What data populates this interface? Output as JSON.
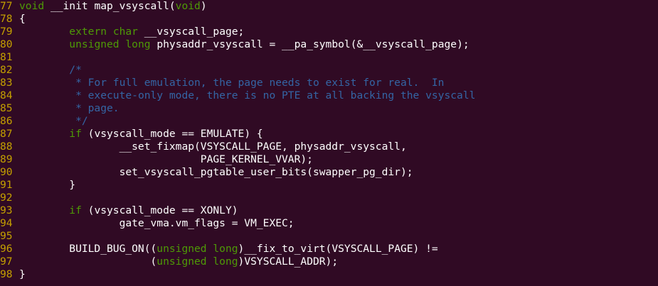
{
  "editor": {
    "colors": {
      "background": "#300a24",
      "line_number": "#c4a000",
      "keyword": "#4e9a06",
      "comment": "#3465a4",
      "text": "#ffffff"
    },
    "lines": [
      {
        "num": "77",
        "segments": [
          [
            "kw",
            "void"
          ],
          [
            "tx",
            " __init map_vsyscall("
          ],
          [
            "kw",
            "void"
          ],
          [
            "tx",
            ")"
          ]
        ]
      },
      {
        "num": "78",
        "segments": [
          [
            "tx",
            "{"
          ]
        ]
      },
      {
        "num": "79",
        "segments": [
          [
            "tx",
            "        "
          ],
          [
            "kw",
            "extern"
          ],
          [
            "tx",
            " "
          ],
          [
            "kw",
            "char"
          ],
          [
            "tx",
            " __vsyscall_page;"
          ]
        ]
      },
      {
        "num": "80",
        "segments": [
          [
            "tx",
            "        "
          ],
          [
            "kw",
            "unsigned"
          ],
          [
            "tx",
            " "
          ],
          [
            "kw",
            "long"
          ],
          [
            "tx",
            " physaddr_vsyscall = __pa_symbol(&__vsyscall_page);"
          ]
        ]
      },
      {
        "num": "81",
        "segments": []
      },
      {
        "num": "82",
        "segments": [
          [
            "tx",
            "        "
          ],
          [
            "cm",
            "/*"
          ]
        ]
      },
      {
        "num": "83",
        "segments": [
          [
            "tx",
            "         "
          ],
          [
            "cm",
            "* For full emulation, the page needs to exist for real.  In"
          ]
        ]
      },
      {
        "num": "84",
        "segments": [
          [
            "tx",
            "         "
          ],
          [
            "cm",
            "* execute-only mode, there is no PTE at all backing the vsyscall"
          ]
        ]
      },
      {
        "num": "85",
        "segments": [
          [
            "tx",
            "         "
          ],
          [
            "cm",
            "* page."
          ]
        ]
      },
      {
        "num": "86",
        "segments": [
          [
            "tx",
            "         "
          ],
          [
            "cm",
            "*/"
          ]
        ]
      },
      {
        "num": "87",
        "segments": [
          [
            "tx",
            "        "
          ],
          [
            "kw",
            "if"
          ],
          [
            "tx",
            " (vsyscall_mode == EMULATE) {"
          ]
        ]
      },
      {
        "num": "88",
        "segments": [
          [
            "tx",
            "                __set_fixmap(VSYSCALL_PAGE, physaddr_vsyscall,"
          ]
        ]
      },
      {
        "num": "89",
        "segments": [
          [
            "tx",
            "                             PAGE_KERNEL_VVAR);"
          ]
        ]
      },
      {
        "num": "90",
        "segments": [
          [
            "tx",
            "                set_vsyscall_pgtable_user_bits(swapper_pg_dir);"
          ]
        ]
      },
      {
        "num": "91",
        "segments": [
          [
            "tx",
            "        }"
          ]
        ]
      },
      {
        "num": "92",
        "segments": []
      },
      {
        "num": "93",
        "segments": [
          [
            "tx",
            "        "
          ],
          [
            "kw",
            "if"
          ],
          [
            "tx",
            " (vsyscall_mode == XONLY)"
          ]
        ]
      },
      {
        "num": "94",
        "segments": [
          [
            "tx",
            "                gate_vma.vm_flags = VM_EXEC;"
          ]
        ]
      },
      {
        "num": "95",
        "segments": []
      },
      {
        "num": "96",
        "segments": [
          [
            "tx",
            "        BUILD_BUG_ON(("
          ],
          [
            "kw",
            "unsigned"
          ],
          [
            "tx",
            " "
          ],
          [
            "kw",
            "long"
          ],
          [
            "tx",
            ")__fix_to_virt(VSYSCALL_PAGE) !="
          ]
        ]
      },
      {
        "num": "97",
        "segments": [
          [
            "tx",
            "                     ("
          ],
          [
            "kw",
            "unsigned"
          ],
          [
            "tx",
            " "
          ],
          [
            "kw",
            "long"
          ],
          [
            "tx",
            ")VSYSCALL_ADDR);"
          ]
        ]
      },
      {
        "num": "98",
        "segments": [
          [
            "tx",
            "}"
          ]
        ]
      }
    ]
  }
}
